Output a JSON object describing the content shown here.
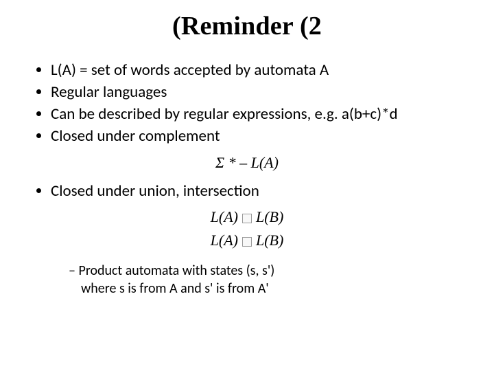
{
  "title": "(Reminder (2",
  "bullets1": {
    "b0": "L(A) = set of words accepted by automata A",
    "b1": "Regular languages",
    "b2": "Can be described by regular expressions, e.g. a(b+c)*d",
    "b3": "Closed under complement"
  },
  "formula1": "Σ * – L(A)",
  "bullets2": {
    "b0": "Closed under union, intersection"
  },
  "formula2": {
    "left": "L(A)",
    "right": "L(B)"
  },
  "sub": {
    "line1": "Product automata with states (s, s')",
    "line2": "where s is from A and s' is from A'"
  }
}
